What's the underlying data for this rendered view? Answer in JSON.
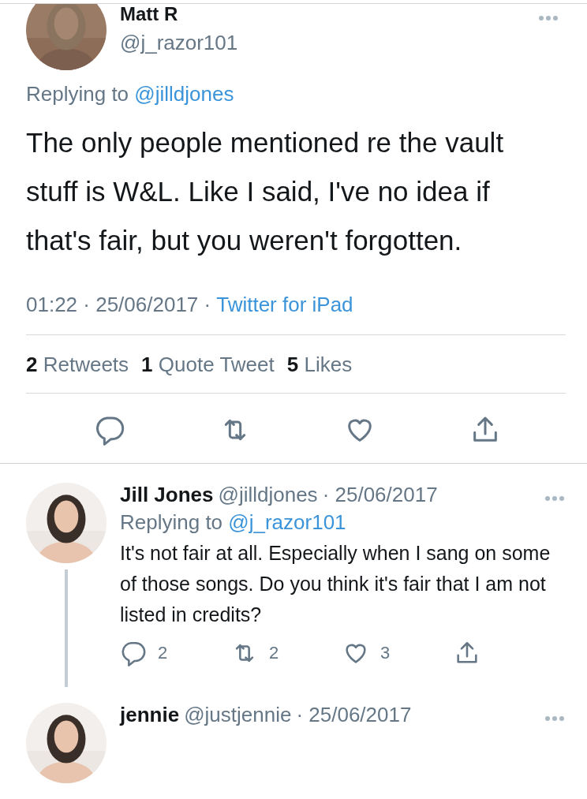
{
  "main_tweet": {
    "name": "Matt R",
    "handle": "@j_razor101",
    "replying_label": "Replying to",
    "replying_to": "@jilldjones",
    "text": "The only people mentioned re the vault stuff is W&L. Like I said, I've no idea if that's fair, but you weren't forgotten.",
    "timestamp": "01:22 · 25/06/2017 ·",
    "source": "Twitter for iPad",
    "stats": [
      {
        "count": "2",
        "label": "Retweets"
      },
      {
        "count": "1",
        "label": "Quote Tweet"
      },
      {
        "count": "5",
        "label": "Likes"
      }
    ],
    "actions": [
      {
        "kind": "reply"
      },
      {
        "kind": "retweet"
      },
      {
        "kind": "like"
      },
      {
        "kind": "share"
      }
    ]
  },
  "replies": [
    {
      "name": "Jill Jones",
      "handle": "@jilldjones",
      "date": "· 25/06/2017",
      "replying_label": "Replying to",
      "replying_to": "@j_razor101",
      "text": "It's not fair at all. Especially when I sang on some of those songs. Do you think it's fair that I am not listed in credits?",
      "actions": [
        {
          "kind": "reply",
          "count": "2"
        },
        {
          "kind": "retweet",
          "count": "2"
        },
        {
          "kind": "like",
          "count": "3"
        },
        {
          "kind": "share"
        }
      ]
    },
    {
      "name": "jennie",
      "handle": "@justjennie",
      "date": "· 25/06/2017"
    }
  ]
}
